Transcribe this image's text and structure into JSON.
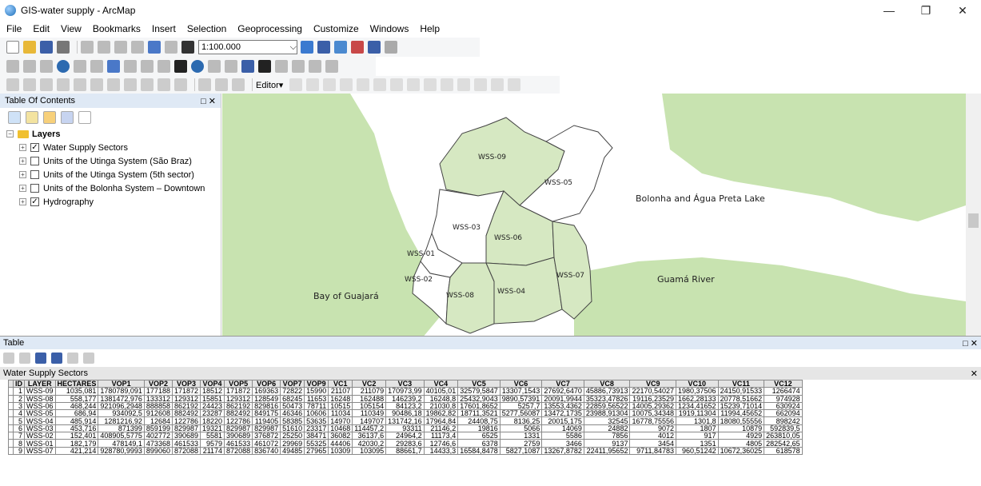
{
  "window": {
    "title": "GIS-water supply - ArcMap"
  },
  "menu": [
    "File",
    "Edit",
    "View",
    "Bookmarks",
    "Insert",
    "Selection",
    "Geoprocessing",
    "Customize",
    "Windows",
    "Help"
  ],
  "toolbar": {
    "scale": "1:100.000",
    "editor_label": "Editor▾"
  },
  "toc": {
    "title": "Table Of Contents",
    "root": "Layers",
    "layers": [
      {
        "label": "Water Supply Sectors",
        "checked": true
      },
      {
        "label": "Units of the Utinga System (São Braz)",
        "checked": false
      },
      {
        "label": "Units of the Utinga System (5th sector)",
        "checked": false
      },
      {
        "label": "Units of the Bolonha System – Downtown",
        "checked": false
      },
      {
        "label": "Hydrography",
        "checked": true
      }
    ]
  },
  "map": {
    "sectors": [
      "WSS-09",
      "WSS-05",
      "WSS-03",
      "WSS-06",
      "WSS-01",
      "WSS-02",
      "WSS-08",
      "WSS-04",
      "WSS-07"
    ],
    "places": {
      "lake": "Bolonha and Água Preta Lake",
      "river": "Guamá River",
      "bay": "Bay of Guajará"
    },
    "colors": {
      "water": "#c8e3b0",
      "land": "#ffffff",
      "sector_fill": "#d6e8c2",
      "sector_stroke": "#444444"
    }
  },
  "table": {
    "window_title": "Table",
    "name": "Water Supply Sectors",
    "columns": [
      "ID",
      "LAYER",
      "HECTARES",
      "VOP1",
      "VOP2",
      "VOP3",
      "VOP4",
      "VOP5",
      "VOP6",
      "VOP7",
      "VOP9",
      "VC1",
      "VC2",
      "VC3",
      "VC4",
      "VC5",
      "VC6",
      "VC7",
      "VC8",
      "VC9",
      "VC10",
      "VC11",
      "VC12"
    ],
    "rows": [
      [
        "1",
        "WSS-09",
        "1035,081",
        "1780789,091",
        "177188",
        "171872",
        "18512",
        "171872",
        "169363",
        "72822",
        "15990",
        "21107",
        "211079",
        "170973,99",
        "40105,01",
        "32579,5847",
        "13307,1543",
        "27692,6470",
        "45886,73913",
        "22170,54027",
        "1980,37506",
        "24150,91533",
        "1266474"
      ],
      [
        "2",
        "WSS-08",
        "558,177",
        "1381472,976",
        "133312",
        "129312",
        "15851",
        "129312",
        "128549",
        "68245",
        "11653",
        "16248",
        "162488",
        "146239,2",
        "16248,8",
        "25432,9043",
        "9890,57391",
        "20091,9944",
        "35323,47826",
        "19116,23529",
        "1662,28133",
        "20778,51662",
        "974928"
      ],
      [
        "3",
        "WSS-06",
        "468,244",
        "921096,2948",
        "888858",
        "862192",
        "24423",
        "862192",
        "829816",
        "50473",
        "78711",
        "10515",
        "105154",
        "84123,2",
        "21030,8",
        "17601,8652",
        "5257,7",
        "13553,4362",
        "22859,56522",
        "14005,29362",
        "1234,41652",
        "15239,71014",
        "630924"
      ],
      [
        "4",
        "WSS-05",
        "686,94",
        "934092,5",
        "912608",
        "882492",
        "23287",
        "882492",
        "849175",
        "46346",
        "10606",
        "11034",
        "110349",
        "90486,18",
        "19862,82",
        "18711,3521",
        "5277,56087",
        "13472,1735",
        "23988,91304",
        "10075,34348",
        "1919,11304",
        "11994,45652",
        "662094"
      ],
      [
        "5",
        "WSS-04",
        "485,914",
        "1281216,92",
        "12684",
        "122786",
        "18220",
        "122786",
        "119405",
        "58385",
        "53635",
        "14970",
        "149707",
        "131742,16",
        "17964,84",
        "24408,75",
        "8136,25",
        "20015,175",
        "32545",
        "16778,75556",
        "1301,8",
        "18080,55556",
        "898242"
      ],
      [
        "6",
        "WSS-03",
        "453,716",
        "871399",
        "859199",
        "829987",
        "19321",
        "829987",
        "829987",
        "51610",
        "23317",
        "10468",
        "114457,2",
        "93311",
        "21146,2",
        "19816",
        "5066",
        "14069",
        "24882",
        "9072",
        "1807",
        "10879",
        "592839,5"
      ],
      [
        "7",
        "WSS-02",
        "152,401",
        "408905,5775",
        "402772",
        "390689",
        "5581",
        "390689",
        "376872",
        "25250",
        "38471",
        "36082",
        "36137,6",
        "24964,2",
        "11173,4",
        "6525",
        "1331",
        "5586",
        "7856",
        "4012",
        "917",
        "4929",
        "263810,05"
      ],
      [
        "8",
        "WSS-01",
        "182,179",
        "478149,1",
        "473368",
        "461533",
        "9579",
        "461533",
        "461072",
        "29969",
        "55325",
        "44406",
        "42030,2",
        "29283,6",
        "12746,6",
        "6378",
        "2759",
        "3466",
        "9137",
        "3454",
        "1351",
        "4805",
        "282542,65"
      ],
      [
        "9",
        "WSS-07",
        "421,214",
        "928780,9993",
        "899060",
        "872088",
        "21174",
        "872088",
        "836740",
        "49485",
        "27965",
        "10309",
        "103095",
        "88661,7",
        "14433,3",
        "16584,8478",
        "5827,1087",
        "13267,8782",
        "22411,95652",
        "9711,84783",
        "960,51242",
        "10672,36025",
        "618578"
      ]
    ]
  }
}
